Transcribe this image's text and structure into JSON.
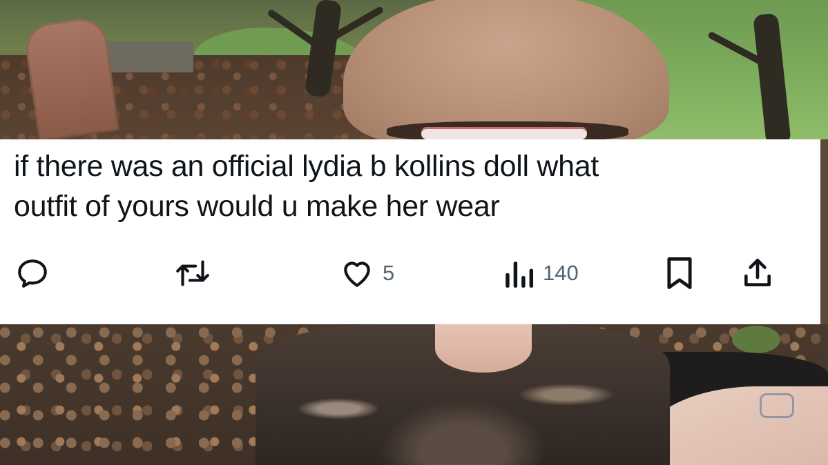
{
  "tweet": {
    "text_line1": "if there was an official lydia b kollins doll what",
    "text_line2": "outfit of yours would u make her wear",
    "actions": {
      "reply": {
        "icon": "reply-icon"
      },
      "retweet": {
        "icon": "retweet-icon"
      },
      "like": {
        "icon": "heart-icon",
        "count": "5"
      },
      "views": {
        "icon": "views-chart-icon",
        "count": "140"
      },
      "bookmark": {
        "icon": "bookmark-icon"
      },
      "share": {
        "icon": "share-icon"
      }
    },
    "colors": {
      "text": "#0f1419",
      "icon": "#536471",
      "card_background": "#ffffff"
    }
  }
}
